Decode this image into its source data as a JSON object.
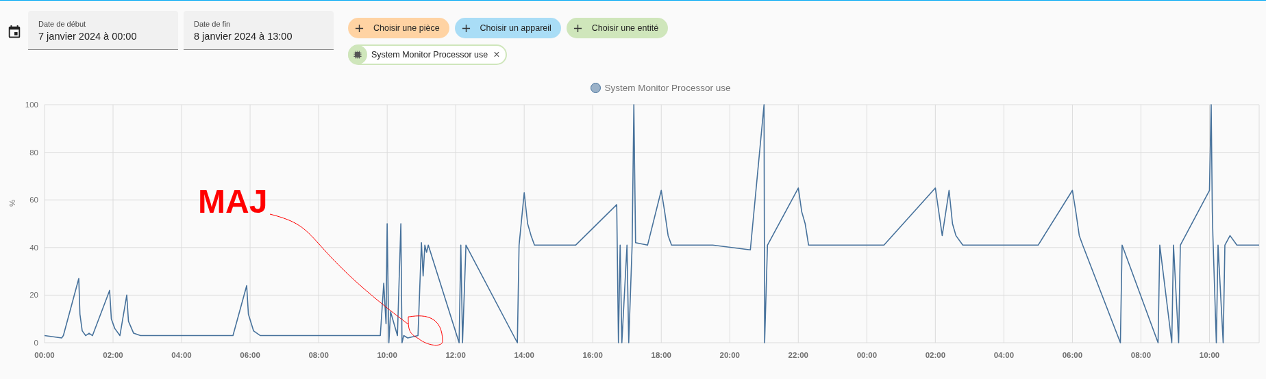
{
  "date_range": {
    "start": {
      "label": "Date de début",
      "value": "7 janvier 2024 à 00:00"
    },
    "end": {
      "label": "Date de fin",
      "value": "8 janvier 2024 à 13:00"
    }
  },
  "pickers": [
    {
      "label": "Choisir une pièce",
      "color": "#ffd3a3"
    },
    {
      "label": "Choisir un appareil",
      "color": "#a9ddf6"
    },
    {
      "label": "Choisir une entité",
      "color": "#cfe6bb"
    }
  ],
  "selected_entities": [
    {
      "label": "System Monitor Processor use",
      "remove": "×"
    }
  ],
  "chart_data": {
    "type": "line",
    "ylabel": "%",
    "xlim": [
      "2024-01-07T00:00",
      "2024-01-08T11:27"
    ],
    "ylim": [
      0,
      100
    ],
    "xticks": [
      {
        "value": "2024-01-07T00:00",
        "label": "00:00"
      },
      {
        "value": "2024-01-07T02:00",
        "label": "02:00"
      },
      {
        "value": "2024-01-07T04:00",
        "label": "04:00"
      },
      {
        "value": "2024-01-07T06:00",
        "label": "06:00"
      },
      {
        "value": "2024-01-07T08:00",
        "label": "08:00"
      },
      {
        "value": "2024-01-07T10:00",
        "label": "10:00"
      },
      {
        "value": "2024-01-07T12:00",
        "label": "12:00"
      },
      {
        "value": "2024-01-07T14:00",
        "label": "14:00"
      },
      {
        "value": "2024-01-07T16:00",
        "label": "16:00"
      },
      {
        "value": "2024-01-07T18:00",
        "label": "18:00"
      },
      {
        "value": "2024-01-07T20:00",
        "label": "20:00"
      },
      {
        "value": "2024-01-07T22:00",
        "label": "22:00"
      },
      {
        "value": "2024-01-08T00:00",
        "label": "00:00"
      },
      {
        "value": "2024-01-08T02:00",
        "label": "02:00"
      },
      {
        "value": "2024-01-08T04:00",
        "label": "04:00"
      },
      {
        "value": "2024-01-08T06:00",
        "label": "06:00"
      },
      {
        "value": "2024-01-08T08:00",
        "label": "08:00"
      },
      {
        "value": "2024-01-08T10:00",
        "label": "10:00"
      }
    ],
    "yticks": [
      0,
      20,
      40,
      60,
      80,
      100
    ],
    "grid": true,
    "x": [
      "2024-01-07T00:00",
      "2024-01-07T00:30",
      "2024-01-07T00:33",
      "2024-01-07T01:00",
      "2024-01-07T01:02",
      "2024-01-07T01:06",
      "2024-01-07T01:12",
      "2024-01-07T01:18",
      "2024-01-07T01:24",
      "2024-01-07T01:54",
      "2024-01-07T01:57",
      "2024-01-07T02:03",
      "2024-01-07T02:12",
      "2024-01-07T02:24",
      "2024-01-07T02:27",
      "2024-01-07T02:36",
      "2024-01-07T02:48",
      "2024-01-07T03:30",
      "2024-01-07T04:30",
      "2024-01-07T05:30",
      "2024-01-07T05:54",
      "2024-01-07T05:57",
      "2024-01-07T06:06",
      "2024-01-07T06:18",
      "2024-01-07T07:30",
      "2024-01-07T08:48",
      "2024-01-07T09:48",
      "2024-01-07T09:54",
      "2024-01-07T09:58",
      "2024-01-07T10:00",
      "2024-01-07T10:03",
      "2024-01-07T10:06",
      "2024-01-07T10:18",
      "2024-01-07T10:24",
      "2024-01-07T10:26",
      "2024-01-07T10:29",
      "2024-01-07T10:36",
      "2024-01-07T10:54",
      "2024-01-07T11:00",
      "2024-01-07T11:03",
      "2024-01-07T11:06",
      "2024-01-07T11:09",
      "2024-01-07T11:12",
      "2024-01-07T12:06",
      "2024-01-07T12:09",
      "2024-01-07T12:12",
      "2024-01-07T12:18",
      "2024-01-07T13:48",
      "2024-01-07T13:51",
      "2024-01-07T14:00",
      "2024-01-07T14:06",
      "2024-01-07T14:12",
      "2024-01-07T14:18",
      "2024-01-07T15:30",
      "2024-01-07T16:42",
      "2024-01-07T16:45",
      "2024-01-07T16:48",
      "2024-01-07T16:51",
      "2024-01-07T17:00",
      "2024-01-07T17:03",
      "2024-01-07T17:09",
      "2024-01-07T17:12",
      "2024-01-07T17:15",
      "2024-01-07T17:36",
      "2024-01-07T18:00",
      "2024-01-07T18:06",
      "2024-01-07T18:12",
      "2024-01-07T18:18",
      "2024-01-07T19:30",
      "2024-01-07T20:36",
      "2024-01-07T21:00",
      "2024-01-07T21:01",
      "2024-01-07T21:06",
      "2024-01-07T22:00",
      "2024-01-07T22:06",
      "2024-01-07T22:12",
      "2024-01-07T22:18",
      "2024-01-07T23:30",
      "2024-01-08T00:30",
      "2024-01-08T02:00",
      "2024-01-08T02:06",
      "2024-01-08T02:12",
      "2024-01-08T02:24",
      "2024-01-08T02:30",
      "2024-01-08T02:36",
      "2024-01-08T02:48",
      "2024-01-08T04:00",
      "2024-01-08T05:00",
      "2024-01-08T06:00",
      "2024-01-08T06:06",
      "2024-01-08T06:12",
      "2024-01-08T06:18",
      "2024-01-08T07:24",
      "2024-01-08T07:27",
      "2024-01-08T08:30",
      "2024-01-08T08:33",
      "2024-01-08T08:54",
      "2024-01-08T08:57",
      "2024-01-08T09:06",
      "2024-01-08T09:09",
      "2024-01-08T10:00",
      "2024-01-08T10:03",
      "2024-01-08T10:05",
      "2024-01-08T10:06",
      "2024-01-08T10:12",
      "2024-01-08T10:15",
      "2024-01-08T10:24",
      "2024-01-08T10:27",
      "2024-01-08T10:36",
      "2024-01-08T10:48",
      "2024-01-08T11:27"
    ],
    "series": [
      {
        "name": "System Monitor Processor use",
        "color": "#46719b",
        "values": [
          3,
          2,
          3,
          27,
          12,
          5,
          3,
          4,
          3,
          22,
          10,
          6,
          3,
          20,
          9,
          4,
          3,
          3,
          3,
          3,
          24,
          12,
          5,
          3,
          3,
          3,
          3,
          25,
          8,
          50,
          0,
          13,
          3,
          50,
          0,
          3,
          2,
          3,
          42,
          28,
          41,
          38,
          41,
          0,
          41,
          0,
          41,
          0,
          41,
          63,
          50,
          45,
          41,
          41,
          58,
          0,
          41,
          0,
          41,
          0,
          41,
          100,
          42,
          41,
          64,
          55,
          45,
          41,
          41,
          39,
          100,
          0,
          41,
          65,
          55,
          50,
          41,
          41,
          41,
          65,
          55,
          45,
          64,
          50,
          45,
          41,
          41,
          41,
          64,
          55,
          45,
          41,
          0,
          41,
          0,
          41,
          0,
          41,
          0,
          41,
          64,
          100,
          55,
          45,
          0,
          41,
          0,
          41,
          45,
          41,
          41
        ]
      }
    ],
    "annotations": [
      "MAJ"
    ]
  }
}
